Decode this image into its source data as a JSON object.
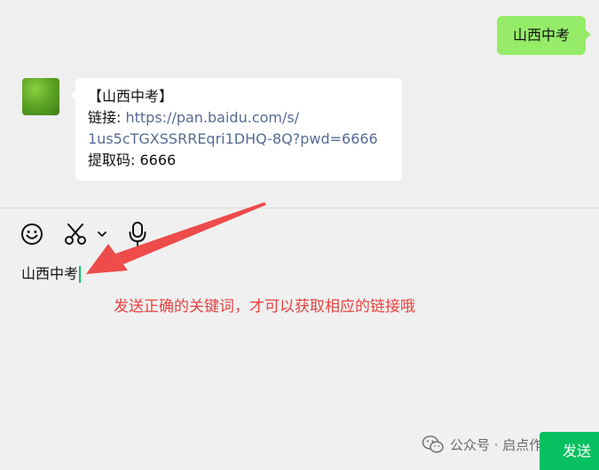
{
  "chat": {
    "outgoing_message": "山西中考",
    "incoming_message": {
      "line1": "【山西中考】",
      "link_label": "链接: ",
      "link_url_part1": "https://pan.baidu.com/s/",
      "link_url_part2": "1us5cTGXSSRREqri1DHQ-8Q?pwd=6666",
      "code_line": "提取码: 6666"
    }
  },
  "toolbar": {
    "icons": [
      "emoji-icon",
      "scissors-icon",
      "chevron-down-icon",
      "microphone-icon"
    ]
  },
  "composer": {
    "input_value": "山西中考",
    "send_label": "发送"
  },
  "annotation": {
    "text": "发送正确的关键词，才可以获取相应的链接哦",
    "color": "#e64340"
  },
  "watermark": {
    "text": "公众号 · 启点作业"
  },
  "colors": {
    "outgoing_bubble": "#95ec69",
    "send_button": "#07c160",
    "link": "#576b95"
  }
}
